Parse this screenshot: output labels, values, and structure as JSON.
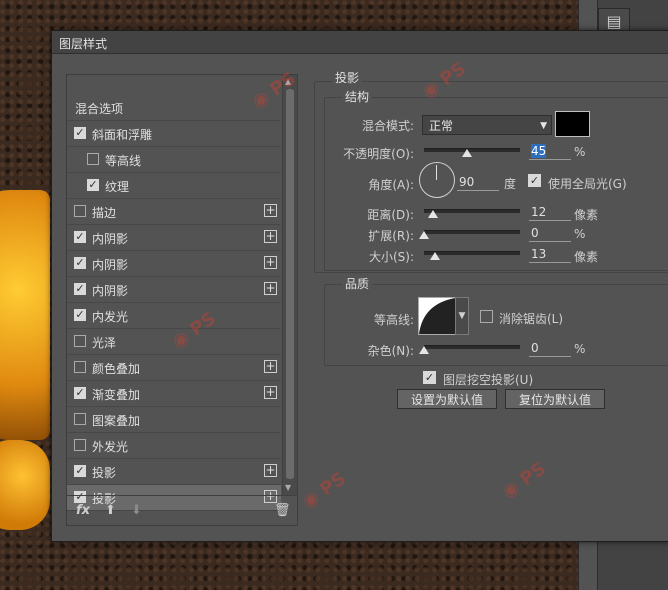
{
  "dialog": {
    "title": "图层样式"
  },
  "style_list": {
    "items": [
      {
        "label": "混合选项",
        "checkbox": null,
        "plus": false,
        "indent": 0,
        "selected": false
      },
      {
        "label": "斜面和浮雕",
        "checkbox": true,
        "plus": false,
        "indent": 0,
        "selected": false
      },
      {
        "label": "等高线",
        "checkbox": false,
        "plus": false,
        "indent": 1,
        "selected": false
      },
      {
        "label": "纹理",
        "checkbox": true,
        "plus": false,
        "indent": 1,
        "selected": false
      },
      {
        "label": "描边",
        "checkbox": false,
        "plus": true,
        "indent": 0,
        "selected": false
      },
      {
        "label": "内阴影",
        "checkbox": true,
        "plus": true,
        "indent": 0,
        "selected": false
      },
      {
        "label": "内阴影",
        "checkbox": true,
        "plus": true,
        "indent": 0,
        "selected": false
      },
      {
        "label": "内阴影",
        "checkbox": true,
        "plus": true,
        "indent": 0,
        "selected": false
      },
      {
        "label": "内发光",
        "checkbox": true,
        "plus": false,
        "indent": 0,
        "selected": false
      },
      {
        "label": "光泽",
        "checkbox": false,
        "plus": false,
        "indent": 0,
        "selected": false
      },
      {
        "label": "颜色叠加",
        "checkbox": false,
        "plus": true,
        "indent": 0,
        "selected": false
      },
      {
        "label": "渐变叠加",
        "checkbox": true,
        "plus": true,
        "indent": 0,
        "selected": false
      },
      {
        "label": "图案叠加",
        "checkbox": false,
        "plus": false,
        "indent": 0,
        "selected": false
      },
      {
        "label": "外发光",
        "checkbox": false,
        "plus": false,
        "indent": 0,
        "selected": false
      },
      {
        "label": "投影",
        "checkbox": true,
        "plus": true,
        "indent": 0,
        "selected": false
      },
      {
        "label": "投影",
        "checkbox": true,
        "plus": true,
        "indent": 0,
        "selected": true
      }
    ],
    "bottom": {
      "fx": "fx",
      "up": "⬆",
      "down": "⬇",
      "trash": "🗑"
    }
  },
  "panel": {
    "section": "投影",
    "structure": {
      "legend": "结构",
      "blend_mode_label": "混合模式:",
      "blend_mode_value": "正常",
      "shadow_color": "#000000",
      "opacity_label": "不透明度(O):",
      "opacity_value": "45",
      "opacity_unit": "%",
      "opacity_level": 45,
      "angle_label": "角度(A):",
      "angle_value": "90",
      "angle_unit": "度",
      "global_light_label": "使用全局光(G)",
      "global_light": true,
      "distance_label": "距离(D):",
      "distance_value": "12",
      "distance_unit": "像素",
      "spread_label": "扩展(R):",
      "spread_value": "0",
      "spread_unit": "%",
      "size_label": "大小(S):",
      "size_value": "13",
      "size_unit": "像素"
    },
    "quality": {
      "legend": "品质",
      "contour_label": "等高线:",
      "antialias_label": "消除锯齿(L)",
      "antialias": false,
      "noise_label": "杂色(N):",
      "noise_value": "0",
      "noise_unit": "%"
    },
    "knockout_label": "图层挖空投影(U)",
    "knockout": true,
    "default_button": "设置为默认值",
    "reset_button": "复位为默认值"
  },
  "colors": {
    "accent_select": "#2c6fbd",
    "watermark": "#e33c28"
  }
}
